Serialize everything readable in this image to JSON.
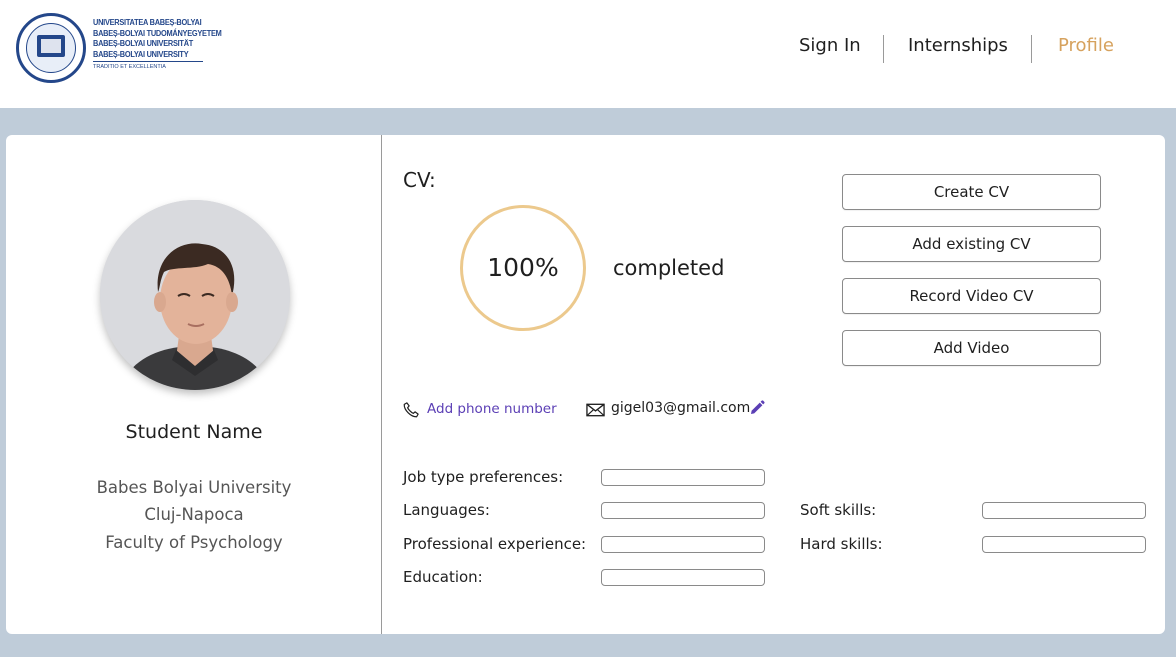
{
  "header": {
    "logo": {
      "lines": [
        "UNIVERSITATEA BABEȘ-BOLYAI",
        "BABEȘ-BOLYAI TUDOMÁNYEGYETEM",
        "BABEȘ-BOLYAI UNIVERSITÄT",
        "BABEȘ-BOLYAI UNIVERSITY"
      ],
      "motto": "TRADITIO ET EXCELLENTIA",
      "seal_icon": "university-seal-icon"
    },
    "nav": [
      {
        "label": "Sign In",
        "active": false
      },
      {
        "label": "Internships",
        "active": false
      },
      {
        "label": "Profile",
        "active": true
      }
    ],
    "active_color": "#d6a25e"
  },
  "profile": {
    "name": "Student Name",
    "university": "Babes Bolyai University",
    "city": "Cluj-Napoca",
    "faculty": "Faculty of Psychology"
  },
  "cv": {
    "label": "CV:",
    "progress_percent": 100,
    "progress_text": "100%",
    "status_text": "completed",
    "ring_color": "#ecc98d",
    "buttons": [
      "Create CV",
      "Add existing CV",
      "Record Video CV",
      "Add Video"
    ]
  },
  "contact": {
    "phone_placeholder": "Add phone number",
    "email": "gigel03@gmail.com",
    "link_color": "#5b3fb5"
  },
  "fields": {
    "job_type": "Job type preferences:",
    "languages": "Languages:",
    "professional_experience": "Professional experience:",
    "education": "Education:",
    "soft_skills": "Soft skills:",
    "hard_skills": "Hard skills:"
  },
  "colors": {
    "page_background": "#bfccd9",
    "card_background": "#ffffff"
  }
}
